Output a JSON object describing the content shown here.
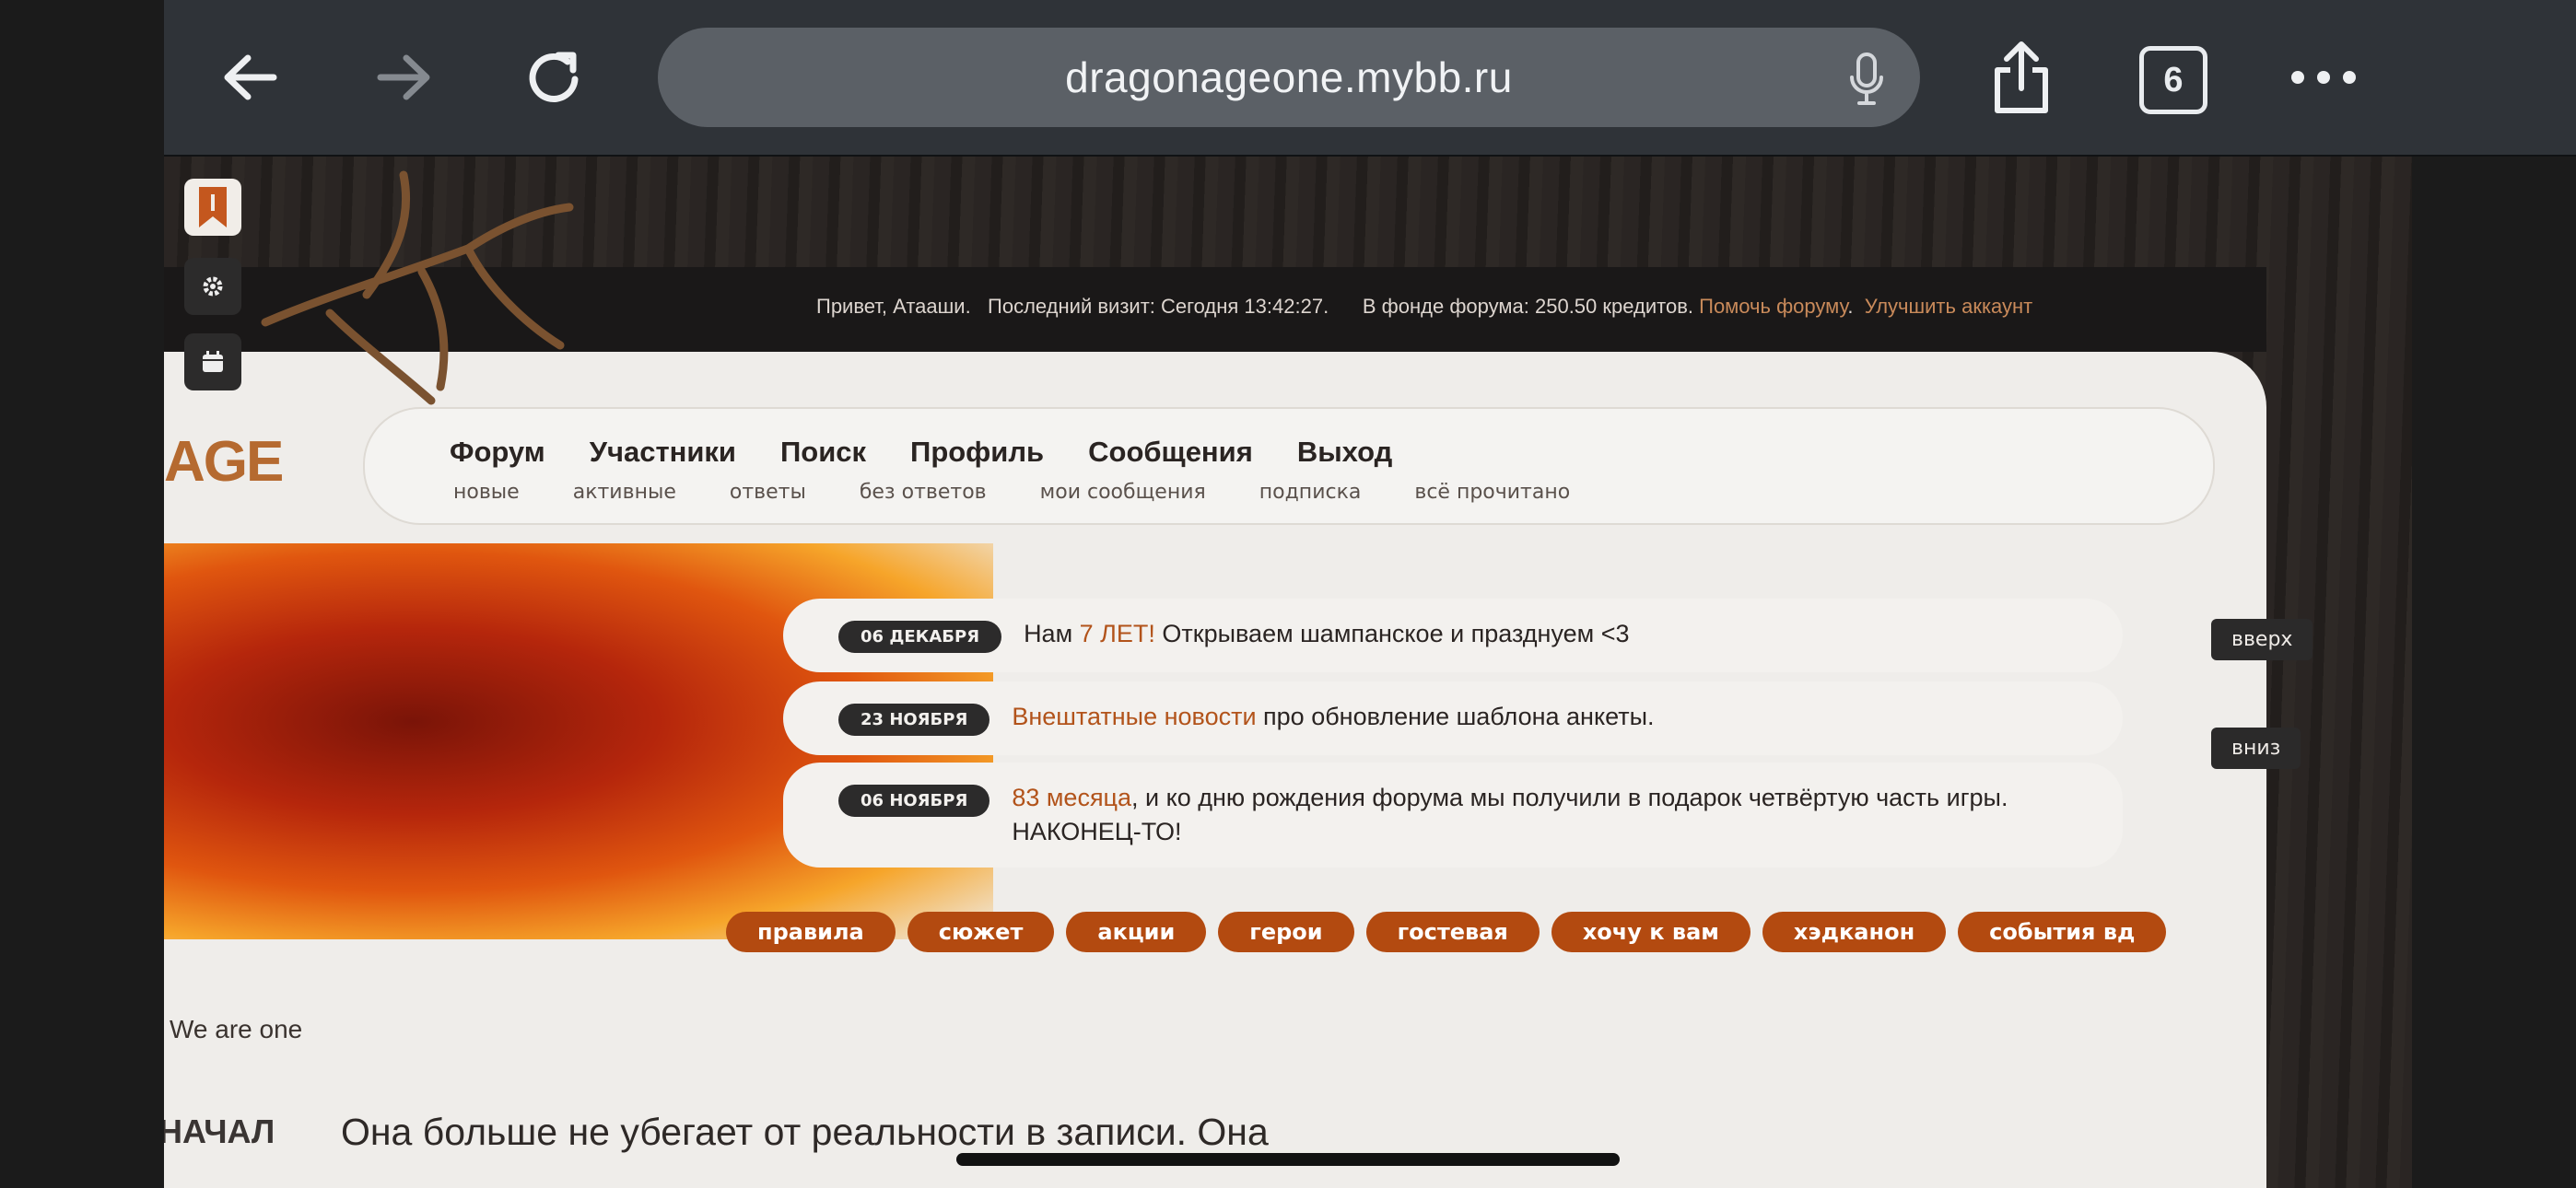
{
  "browser": {
    "url": "dragonageone.mybb.ru",
    "tab_count": "6",
    "icons": [
      "back-arrow-icon",
      "forward-arrow-icon",
      "reload-icon",
      "microphone-icon",
      "share-icon",
      "tabs-icon",
      "more-icon"
    ]
  },
  "userbar": {
    "greeting": "Привет, Атааши.",
    "last_visit": "Последний визит: Сегодня 13:42:27.",
    "fund": "В фонде форума: 250.50 кредитов.",
    "help_link": "Помочь форуму",
    "upgrade_link": "Улучшить аккаунт"
  },
  "logo_text": "AGE",
  "nav": {
    "main": [
      "Форум",
      "Участники",
      "Поиск",
      "Профиль",
      "Сообщения",
      "Выход"
    ],
    "sub": [
      "новые",
      "активные",
      "ответы",
      "без ответов",
      "мои сообщения",
      "подписка",
      "всё прочитано"
    ]
  },
  "news": [
    {
      "date": "06 ДЕКАБРЯ",
      "pre": "Нам ",
      "hl": "7 ЛЕТ!",
      "post": " Открываем шампанское и празднуем <3"
    },
    {
      "date": "23 НОЯБРЯ",
      "pre": "",
      "hl": "Внештатные новости",
      "post": " про обновление шаблона анкеты."
    },
    {
      "date": "06 НОЯБРЯ",
      "pre": "",
      "hl": "83 месяца",
      "post": ", и ко дню рождения форума мы получили в подарок четвёртую часть игры. НАКОНЕЦ-ТО!"
    }
  ],
  "scroll": {
    "up": "вверх",
    "down": "вниз"
  },
  "tags": [
    "правила",
    "сюжет",
    "акции",
    "герои",
    "гостевая",
    "хочу к вам",
    "хэдканон",
    "события вд"
  ],
  "tagline": "We are one",
  "section_label": "НАЧАЛ",
  "quote": "Она больше не убегает от реальности в записи. Она",
  "colors": {
    "accent": "#b34a10",
    "link": "#c98a5a",
    "chrome": "#2f3338",
    "paper": "#efedea"
  }
}
